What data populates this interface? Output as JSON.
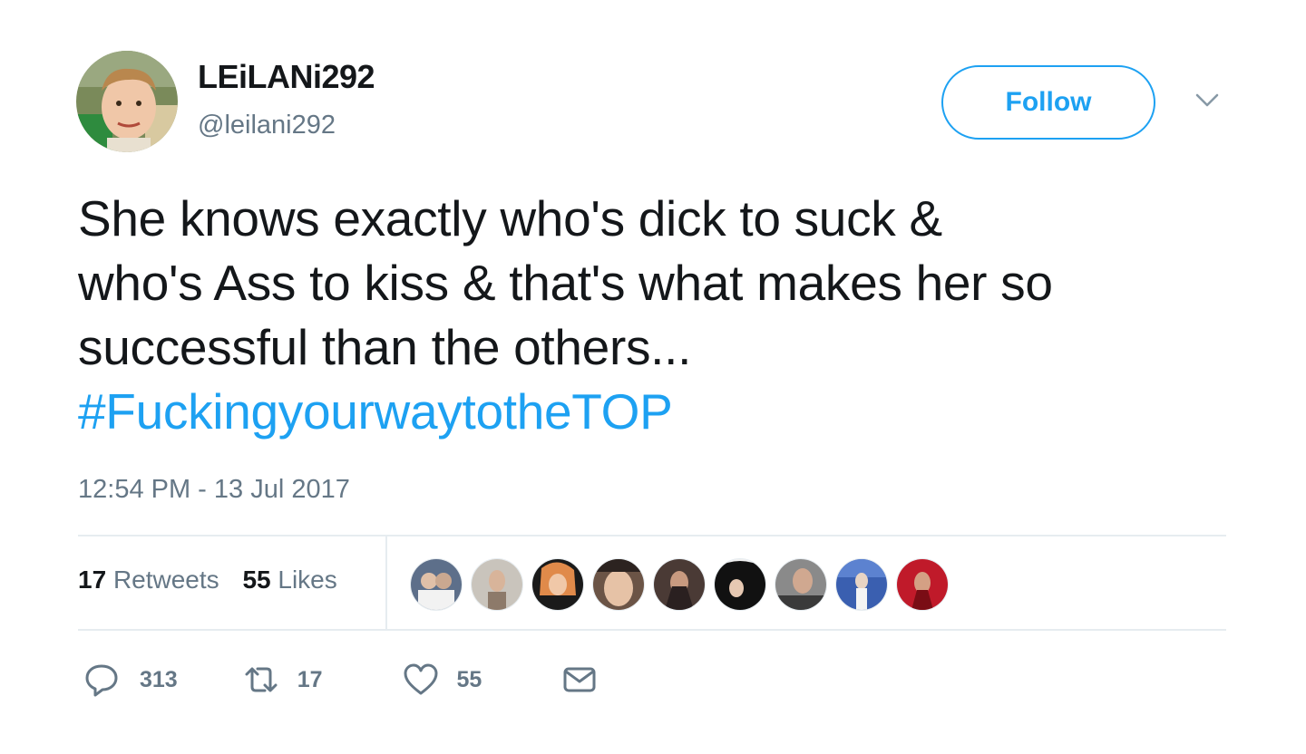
{
  "user": {
    "display_name": "LEiLANi292",
    "handle": "@leilani292"
  },
  "follow_label": "Follow",
  "tweet": {
    "lines": [
      "She knows exactly who's dick to suck &",
      "who's Ass to kiss & that's what makes her so",
      "successful than the others..."
    ],
    "hashtag": "#FuckingyourwaytotheTOP",
    "timestamp": "12:54 PM - 13 Jul 2017"
  },
  "stats": {
    "retweets_count": "17",
    "retweets_label": "Retweets",
    "likes_count": "55",
    "likes_label": "Likes"
  },
  "actions": {
    "reply_count": "313",
    "retweet_count": "17",
    "like_count": "55"
  },
  "colors": {
    "accent": "#1da1f2",
    "secondary_text": "#657786",
    "primary_text": "#14171a",
    "divider": "#e6ecf0"
  },
  "icons": [
    "chevron-down-icon",
    "reply-icon",
    "retweet-icon",
    "heart-icon",
    "envelope-icon"
  ]
}
